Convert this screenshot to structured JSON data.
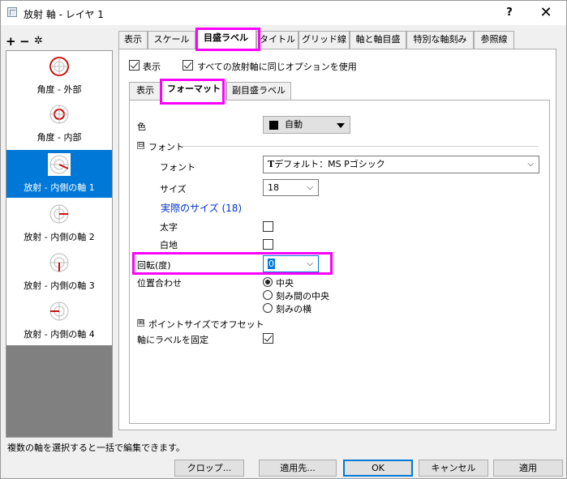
{
  "window": {
    "title": "放射 軸 - レイヤ 1",
    "help_label": "?",
    "close_label": "✕"
  },
  "tree_toolbar": {
    "add_label": "+",
    "remove_label": "−",
    "settings_label": "✲"
  },
  "axes_list": [
    {
      "label": "角度 - 外部",
      "selected": false
    },
    {
      "label": "角度 - 内部",
      "selected": false
    },
    {
      "label": "放射 - 内側の軸 1",
      "selected": true
    },
    {
      "label": "放射 - 内側の軸 2",
      "selected": false
    },
    {
      "label": "放射 - 内側の軸 3",
      "selected": false
    },
    {
      "label": "放射 - 内側の軸 4",
      "selected": false
    }
  ],
  "main_tabs": [
    {
      "label": "表示"
    },
    {
      "label": "スケール"
    },
    {
      "label": "目盛ラベル",
      "active": true
    },
    {
      "label": "タイトル"
    },
    {
      "label": "グリッド線"
    },
    {
      "label": "軸と軸目盛"
    },
    {
      "label": "特別な軸刻み"
    },
    {
      "label": "参照線"
    }
  ],
  "top_options": {
    "show_label": "表示",
    "show_checked": true,
    "same_options_label": "すべての放射軸に同じオプションを使用",
    "same_options_checked": true
  },
  "sub_tabs": [
    {
      "label": "表示"
    },
    {
      "label": "フォーマット",
      "active": true
    },
    {
      "label": "副目盛ラベル"
    }
  ],
  "format": {
    "color_label": "色",
    "color_value": "自動",
    "color_swatch": "#000000",
    "font_section_label": "フォント",
    "font_section_expander": "⊟",
    "font_label": "フォント",
    "font_value": "デフォルト：MS Pゴシック",
    "size_label": "サイズ",
    "size_value": "18",
    "actual_size_label": "実際のサイズ (18)",
    "bold_label": "太字",
    "bold_checked": false,
    "whiteout_label": "白地",
    "whiteout_checked": false,
    "rotation_label": "回転(度)",
    "rotation_value": "0",
    "alignment_label": "位置合わせ",
    "alignment_options": [
      {
        "label": "中央",
        "selected": true
      },
      {
        "label": "刻み間の中央",
        "selected": false
      },
      {
        "label": "刻みの横",
        "selected": false
      }
    ],
    "offset_section_label": "ポイントサイズでオフセット",
    "offset_section_expander": "⊞",
    "fix_label_label": "軸にラベルを固定",
    "fix_label_checked": true
  },
  "status_text": "複数の軸を選択すると一括で編集できます。",
  "buttons": {
    "crop": "クロップ...",
    "apply_to": "適用先...",
    "ok": "OK",
    "cancel": "キャンセル",
    "apply": "適用"
  },
  "colors": {
    "selection": "#0078d7",
    "highlight": "#ff00ff",
    "link": "#0033cc"
  }
}
